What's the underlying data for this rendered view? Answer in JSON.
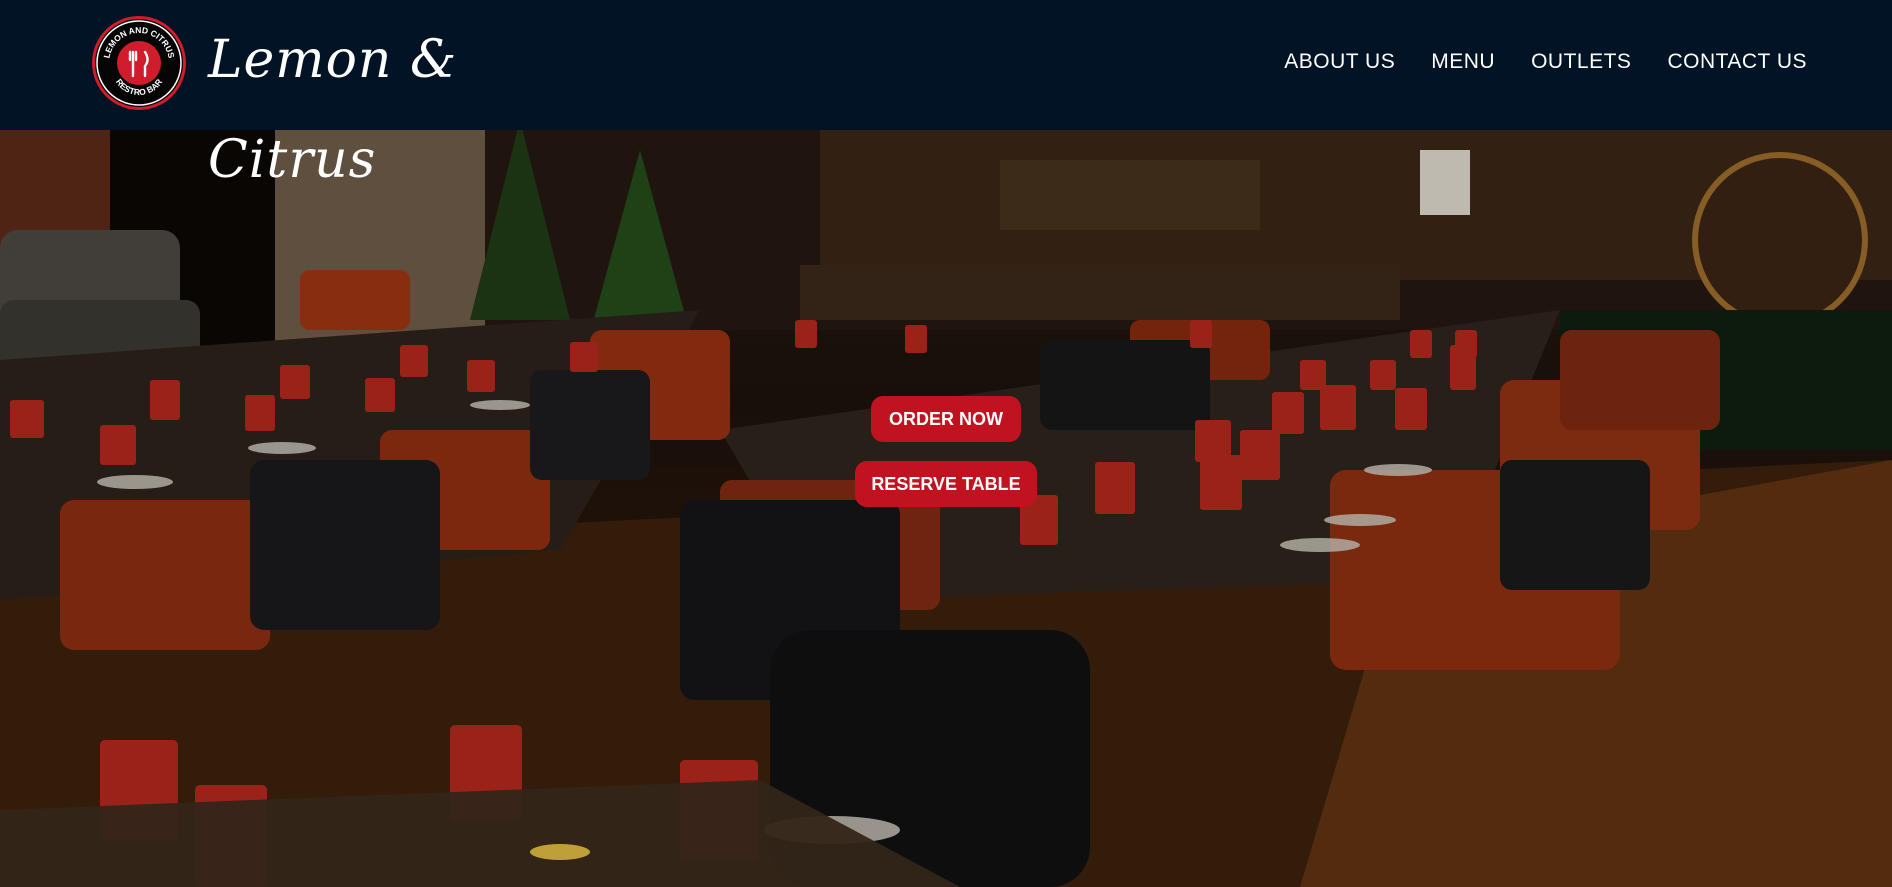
{
  "header": {
    "logo": {
      "ring_text_top": "LEMON AND CITRUS",
      "ring_text_bottom": "RESTRO BAR",
      "icon": "fork-knife-icon"
    },
    "brand_name": "Lemon & Citrus",
    "nav": [
      {
        "label": "ABOUT US"
      },
      {
        "label": "MENU"
      },
      {
        "label": "OUTLETS"
      },
      {
        "label": "CONTACT US"
      }
    ]
  },
  "hero": {
    "background": "restaurant-interior-photo",
    "buttons": {
      "order_now": "ORDER NOW",
      "reserve_table": "RESERVE TABLE"
    }
  },
  "colors": {
    "header_bg": "#011324",
    "accent_red": "#c1131f",
    "text_white": "#ffffff"
  }
}
